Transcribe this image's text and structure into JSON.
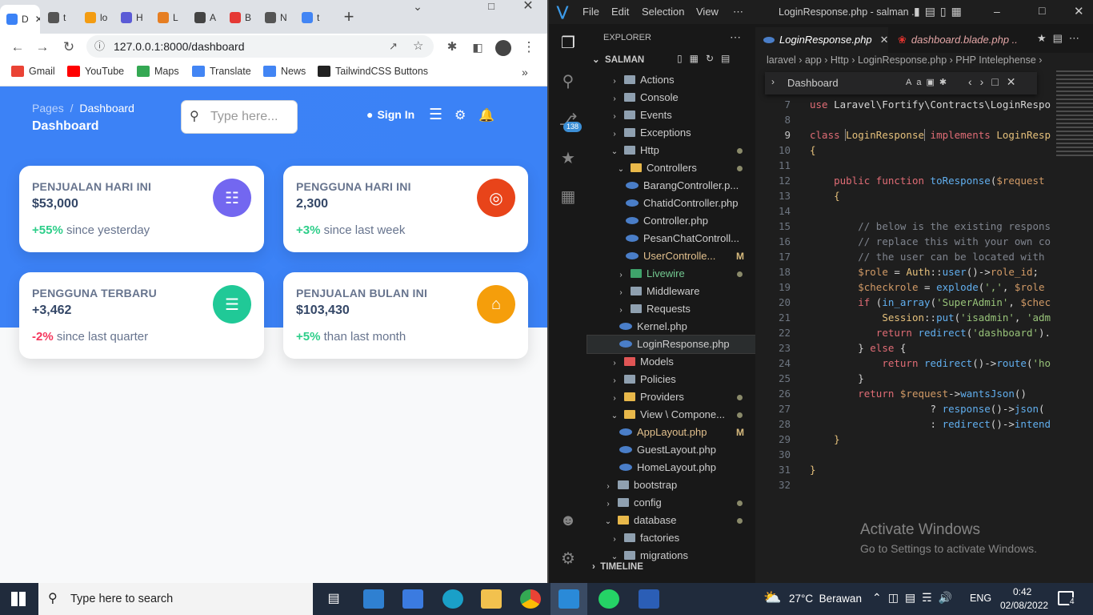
{
  "browser": {
    "tabs": [
      {
        "label": "D",
        "color": "#3b82f6",
        "active": true
      },
      {
        "label": "t",
        "color": "#555555"
      },
      {
        "label": "lo",
        "color": "#f39c12"
      },
      {
        "label": "H",
        "color": "#5b5bd6"
      },
      {
        "label": "L",
        "color": "#e67e22"
      },
      {
        "label": "A",
        "color": "#444444"
      },
      {
        "label": "B",
        "color": "#e53935"
      },
      {
        "label": "N",
        "color": "#555555"
      },
      {
        "label": "t",
        "color": "#4285f4"
      }
    ],
    "url": "127.0.0.1:8000/dashboard",
    "bookmarks": [
      {
        "label": "Gmail",
        "color": "#ea4335"
      },
      {
        "label": "YouTube",
        "color": "#ff0000"
      },
      {
        "label": "Maps",
        "color": "#34a853"
      },
      {
        "label": "Translate",
        "color": "#4285f4"
      },
      {
        "label": "News",
        "color": "#4285f4"
      },
      {
        "label": "TailwindCSS Buttons",
        "color": "#222222"
      }
    ]
  },
  "dashboard": {
    "breadcrumb_parent": "Pages",
    "breadcrumb_sep": "/",
    "breadcrumb_current": "Dashboard",
    "title": "Dashboard",
    "search_placeholder": "Type here...",
    "signin_label": "Sign In",
    "cards": [
      {
        "label": "PENJUALAN HARI INI",
        "value": "$53,000",
        "change": "+55%",
        "suffix": " since yesterday",
        "icon": "database-icon",
        "color": "#7367f0",
        "negative": false
      },
      {
        "label": "PENGGUNA HARI INI",
        "value": "2,300",
        "change": "+3%",
        "suffix": " since last week",
        "icon": "globe-icon",
        "color": "#e8441a",
        "negative": false
      },
      {
        "label": "PENGGUNA TERBARU",
        "value": "+3,462",
        "change": "-2%",
        "suffix": " since last quarter",
        "icon": "document-icon",
        "color": "#20c997",
        "negative": true
      },
      {
        "label": "PENJUALAN BULAN INI",
        "value": "$103,430",
        "change": "+5%",
        "suffix": " than last month",
        "icon": "cart-icon",
        "color": "#f59e0b",
        "negative": false
      }
    ]
  },
  "vscode": {
    "menu": [
      "File",
      "Edit",
      "Selection",
      "View",
      "⋯"
    ],
    "window_title": "LoginResponse.php - salman ...",
    "explorer_label": "EXPLORER",
    "root_label": "SALMAN",
    "source_control_badge": "138",
    "timeline_label": "TIMELINE",
    "tree": [
      {
        "label": "Actions",
        "indent": 1,
        "open": false,
        "kind": "folder"
      },
      {
        "label": "Console",
        "indent": 1,
        "open": false,
        "kind": "folder"
      },
      {
        "label": "Events",
        "indent": 1,
        "open": false,
        "kind": "folder"
      },
      {
        "label": "Exceptions",
        "indent": 1,
        "open": false,
        "kind": "folder"
      },
      {
        "label": "Http",
        "indent": 1,
        "open": true,
        "kind": "folder",
        "dot": true
      },
      {
        "label": "Controllers",
        "indent": 2,
        "open": true,
        "kind": "folder-open",
        "dot": true
      },
      {
        "label": "BarangController.p...",
        "indent": 3,
        "kind": "php"
      },
      {
        "label": "ChatidController.php",
        "indent": 3,
        "kind": "php"
      },
      {
        "label": "Controller.php",
        "indent": 3,
        "kind": "php"
      },
      {
        "label": "PesanChatControll...",
        "indent": 3,
        "kind": "php"
      },
      {
        "label": "UserControlle...",
        "indent": 3,
        "kind": "php",
        "mark": "M"
      },
      {
        "label": "Livewire",
        "indent": 2,
        "open": false,
        "kind": "folder",
        "dot": true
      },
      {
        "label": "Middleware",
        "indent": 2,
        "open": false,
        "kind": "folder"
      },
      {
        "label": "Requests",
        "indent": 2,
        "open": false,
        "kind": "folder"
      },
      {
        "label": "Kernel.php",
        "indent": 2,
        "kind": "php"
      },
      {
        "label": "LoginResponse.php",
        "indent": 2,
        "kind": "php",
        "selected": true
      },
      {
        "label": "Models",
        "indent": 1,
        "open": false,
        "kind": "folder"
      },
      {
        "label": "Policies",
        "indent": 1,
        "open": false,
        "kind": "folder"
      },
      {
        "label": "Providers",
        "indent": 1,
        "open": false,
        "kind": "folder",
        "dot": true
      },
      {
        "label": "View \\ Compone...",
        "indent": 1,
        "open": true,
        "kind": "folder-open",
        "dot": true
      },
      {
        "label": "AppLayout.php",
        "indent": 2,
        "kind": "php",
        "mark": "M"
      },
      {
        "label": "GuestLayout.php",
        "indent": 2,
        "kind": "php"
      },
      {
        "label": "HomeLayout.php",
        "indent": 2,
        "kind": "php"
      },
      {
        "label": "bootstrap",
        "indent": 0,
        "open": false,
        "kind": "folder"
      },
      {
        "label": "config",
        "indent": 0,
        "open": false,
        "kind": "folder",
        "dot": true
      },
      {
        "label": "database",
        "indent": 0,
        "open": true,
        "kind": "folder-open",
        "dot": true
      },
      {
        "label": "factories",
        "indent": 1,
        "open": false,
        "kind": "folder"
      },
      {
        "label": "migrations",
        "indent": 1,
        "open": true,
        "kind": "folder"
      }
    ],
    "editor_tabs": [
      {
        "label": "LoginResponse.php",
        "active": true
      },
      {
        "label": "dashboard.blade.php ...\\v",
        "active": false
      }
    ],
    "breadcrumb": [
      "laravel",
      "app",
      "Http",
      "LoginResponse.php",
      "PHP Intelephense"
    ],
    "find_value": "Dashboard",
    "code_lines": [
      {
        "n": "7",
        "html": "<span class=\"k\">use</span> Laravel\\Fortify\\Contracts\\LoginRespo"
      },
      {
        "n": "8",
        "html": ""
      },
      {
        "n": "9",
        "html": "<span class=\"k\">class</span> <span class=\"cl\" style=\"outline:1px solid #888\">LoginResponse</span> <span class=\"k\">implements</span> <span class=\"cl\">LoginResp</span>"
      },
      {
        "n": "10",
        "html": "<span class=\"v\">{</span>"
      },
      {
        "n": "11",
        "html": ""
      },
      {
        "n": "12",
        "html": "    <span class=\"k\">public</span> <span class=\"k\">function</span> <span class=\"f\">toResponse</span>(<span class=\"s\">$request</span>"
      },
      {
        "n": "13",
        "html": "    <span class=\"v\">{</span>"
      },
      {
        "n": "14",
        "html": ""
      },
      {
        "n": "15",
        "html": "        <span class=\"cm\">// below is the existing respons</span>"
      },
      {
        "n": "16",
        "html": "        <span class=\"cm\">// replace this with your own co</span>"
      },
      {
        "n": "17",
        "html": "        <span class=\"cm\">// the user can be located with</span>"
      },
      {
        "n": "18",
        "html": "        <span class=\"s\">$role</span> = <span class=\"cl\">Auth</span>::<span class=\"f\">user</span>()-&gt;<span class=\"s\">role_id</span>;"
      },
      {
        "n": "19",
        "html": "        <span class=\"s\">$checkrole</span> = <span class=\"f\">explode</span>(<span class=\"st\">','</span>, <span class=\"s\">$role</span>"
      },
      {
        "n": "20",
        "html": "        <span class=\"k\">if</span> (<span class=\"f\">in_array</span>(<span class=\"st\">'SuperAdmin'</span>, <span class=\"s\">$chec</span>"
      },
      {
        "n": "21",
        "html": "            <span class=\"cl\">Session</span>::<span class=\"f\">put</span>(<span class=\"st\">'isadmin'</span>, <span class=\"st\">'adm</span>"
      },
      {
        "n": "22",
        "html": "           <span class=\"k\">return</span> <span class=\"f\">redirect</span>(<span class=\"st\">'dashboard'</span>)."
      },
      {
        "n": "23",
        "html": "        } <span class=\"k\">else</span> {"
      },
      {
        "n": "24",
        "html": "            <span class=\"k\">return</span> <span class=\"f\">redirect</span>()-&gt;<span class=\"f\">route</span>(<span class=\"st\">'ho</span>"
      },
      {
        "n": "25",
        "html": "        }"
      },
      {
        "n": "26",
        "html": "        <span class=\"k\">return</span> <span class=\"s\">$request</span>-&gt;<span class=\"f\">wantsJson</span>()"
      },
      {
        "n": "27",
        "html": "                    ? <span class=\"f\">response</span>()-&gt;<span class=\"f\">json</span>("
      },
      {
        "n": "28",
        "html": "                    : <span class=\"f\">redirect</span>()-&gt;<span class=\"f\">intend</span>"
      },
      {
        "n": "29",
        "html": "    <span class=\"v\">}</span>"
      },
      {
        "n": "30",
        "html": ""
      },
      {
        "n": "31",
        "html": "<span class=\"v\">}</span>"
      },
      {
        "n": "32",
        "html": ""
      }
    ],
    "watermark_title": "Activate Windows",
    "watermark_sub": "Go to Settings to activate Windows."
  },
  "taskbar": {
    "search_placeholder": "Type here to search",
    "weather": "27°C  Berawan",
    "lang": "ENG",
    "time": "0:42",
    "date": "02/08/2022",
    "notifications": "4"
  }
}
